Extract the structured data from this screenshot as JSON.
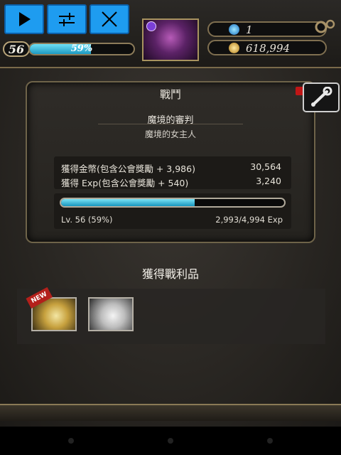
{
  "colors": {
    "accent": "#1e9cf0",
    "exp_bar": "#1d9ac2",
    "gold_border": "#7a6a4a",
    "new_tag": "#b3201b"
  },
  "controls": [
    {
      "name": "play-button",
      "icon": "play-icon"
    },
    {
      "name": "settings-button",
      "icon": "sliders-icon"
    },
    {
      "name": "close-button",
      "icon": "close-icon"
    }
  ],
  "player": {
    "level": "56",
    "exp_percent_label": "59%",
    "exp_fraction": 0.59
  },
  "resources": {
    "gems": "1",
    "gold": "618,994"
  },
  "panel": {
    "title": "戰鬥",
    "stage_name": "魔境的審判",
    "stage_boss": "魔境的女主人",
    "rewards": [
      {
        "label": "獲得金幣(包含公會獎勵 + 3,986)",
        "value": "30,564"
      },
      {
        "label": "獲得 Exp(包含公會獎勵 + 540)",
        "value": "3,240"
      }
    ],
    "level_label": "Lv. 56 (59%)",
    "exp_progress": "2,993/4,994 Exp",
    "exp_fraction": 0.5993
  },
  "loot": {
    "title": "獲得戰利品",
    "new_label": "NEW"
  }
}
